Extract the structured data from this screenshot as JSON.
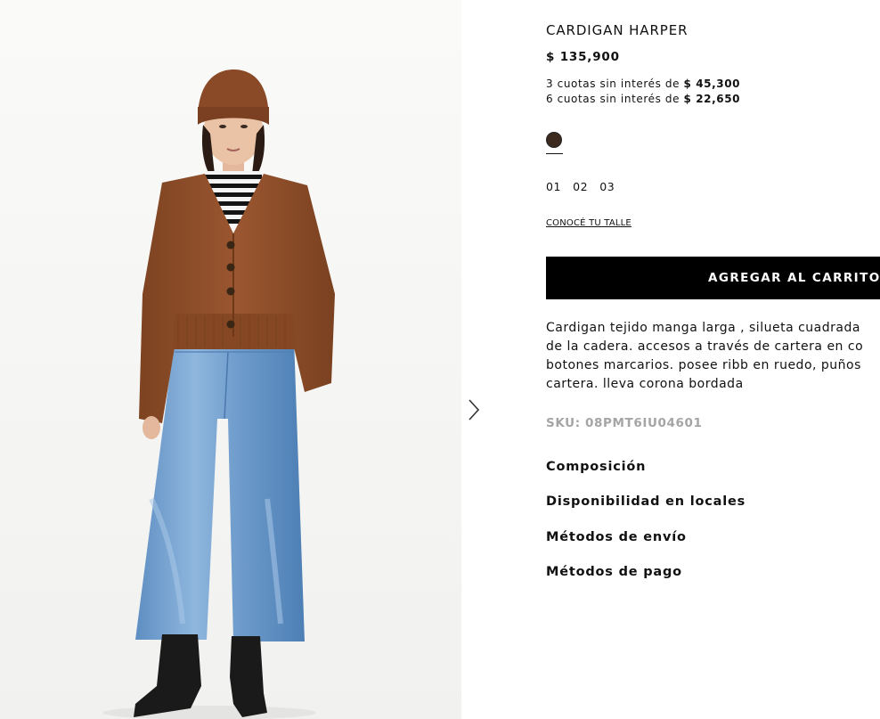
{
  "product": {
    "name": "CARDIGAN HARPER",
    "price": "$ 135,900",
    "installments": [
      {
        "text": "3 cuotas sin interés de ",
        "amount": "$ 45,300"
      },
      {
        "text": "6 cuotas sin interés de ",
        "amount": "$ 22,650"
      }
    ],
    "color": {
      "hex": "#3b2a1d",
      "selected": true
    },
    "sizes": [
      "01",
      "02",
      "03"
    ],
    "size_guide_label": "CONOCÉ TU TALLE",
    "add_to_cart_label": "AGREGAR AL CARRITO",
    "description_lines": [
      "Cardigan tejido manga larga , silueta cuadrada",
      "de la cadera. accesos a través de cartera en co",
      "botones marcarios. posee ribb en ruedo, puños",
      "cartera. lleva corona bordada"
    ],
    "sku": "SKU: 08PMT6IU04601",
    "accordions": [
      "Composición",
      "Disponibilidad en locales",
      "Métodos de envío",
      "Métodos de pago"
    ]
  },
  "gallery": {
    "next_icon": "chevron-right-icon"
  },
  "colors": {
    "button_bg": "#000000",
    "sku_text": "#a5a5a5",
    "background": "#ffffff"
  }
}
